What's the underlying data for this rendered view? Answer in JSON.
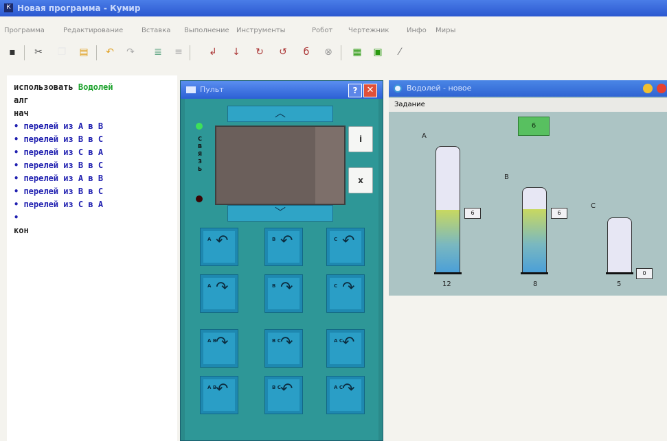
{
  "window": {
    "title": "Новая программа - Кумир"
  },
  "menu": [
    "Программа",
    "Редактирование",
    "Вставка",
    "Выполнение",
    "Инструменты",
    "Робот",
    "Чертежник",
    "Инфо",
    "Миры"
  ],
  "toolbar": {
    "icons": [
      "save-icon",
      "cut-icon",
      "copy-icon",
      "paste-icon",
      "undo-icon",
      "redo-icon",
      "list-icon",
      "list2-icon",
      "step-icon",
      "step-in-icon",
      "step-over-icon",
      "step-out-icon",
      "reset-icon",
      "stop-icon",
      "grid-icon",
      "window-icon",
      "pen-icon"
    ]
  },
  "editor": {
    "lines": [
      {
        "parts": [
          {
            "t": "использовать ",
            "c": "kw"
          },
          {
            "t": "Водолей",
            "c": "mod"
          }
        ]
      },
      {
        "parts": [
          {
            "t": "алг",
            "c": "kw"
          }
        ]
      },
      {
        "parts": [
          {
            "t": "нач",
            "c": "kw"
          }
        ]
      },
      {
        "parts": [
          {
            "t": "• перелей из А в В",
            "c": "cmd"
          }
        ]
      },
      {
        "parts": [
          {
            "t": "• перелей из В в С",
            "c": "cmd"
          }
        ]
      },
      {
        "parts": [
          {
            "t": "• перелей из С в А",
            "c": "cmd"
          }
        ]
      },
      {
        "parts": [
          {
            "t": "• перелей из В в С",
            "c": "cmd"
          }
        ]
      },
      {
        "parts": [
          {
            "t": "• перелей из А в В",
            "c": "cmd"
          }
        ]
      },
      {
        "parts": [
          {
            "t": "• перелей из В в С",
            "c": "cmd"
          }
        ]
      },
      {
        "parts": [
          {
            "t": "• перелей из С в А",
            "c": "cmd"
          }
        ]
      },
      {
        "parts": [
          {
            "t": "•",
            "c": "cmd"
          }
        ]
      },
      {
        "parts": [
          {
            "t": "кон",
            "c": "kw"
          }
        ]
      }
    ]
  },
  "pult": {
    "title": "Пульт",
    "help": "?",
    "close": "✕",
    "up": "︿",
    "down": "﹀",
    "svyaz": "СВЯЗЬ",
    "side_buttons": [
      "i",
      "x"
    ],
    "fill_buttons": [
      "A",
      "B",
      "C"
    ],
    "pour_buttons": [
      "A",
      "B",
      "C"
    ],
    "transfer_row1": [
      [
        "A",
        "B"
      ],
      [
        "B",
        "C"
      ],
      [
        "A",
        "C"
      ]
    ],
    "transfer_row2": [
      [
        "A",
        "B"
      ],
      [
        "B",
        "C"
      ],
      [
        "A",
        "C"
      ]
    ]
  },
  "vodoley": {
    "title": "Водолей - новое",
    "menu": "Задание",
    "target": "6",
    "jugs": [
      {
        "name": "A",
        "capacity": "12",
        "current": "6",
        "fill": 0.5
      },
      {
        "name": "B",
        "capacity": "8",
        "current": "6",
        "fill": 0.75
      },
      {
        "name": "C",
        "capacity": "5",
        "current": "0",
        "fill": 0
      }
    ]
  }
}
